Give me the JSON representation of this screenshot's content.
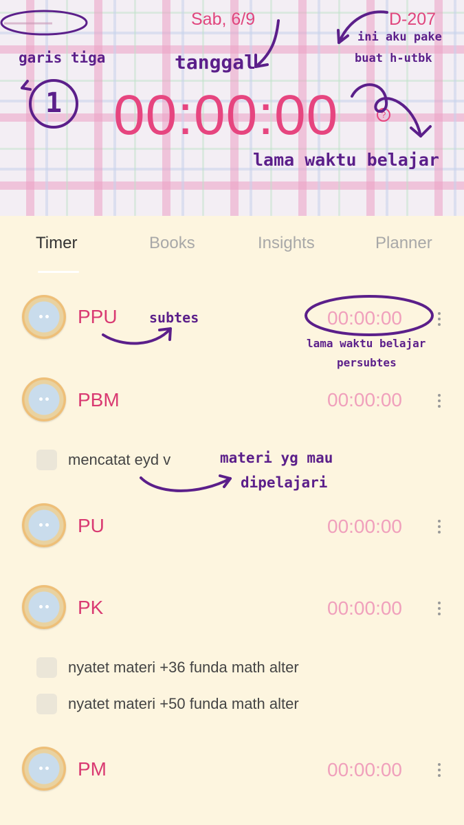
{
  "header": {
    "date": "Sab, 6/9",
    "dday": "D-207",
    "timer": "00:00:00",
    "help_glyph": "?"
  },
  "annotations": {
    "menu": "garis tiga",
    "menu_number": "1",
    "date": "tanggal",
    "dday_line1": "ini aku pake",
    "dday_line2": "buat h-utbk",
    "timer": "lama waktu belajar",
    "subtes": "subtes",
    "row_timer_line1": "lama waktu belajar",
    "row_timer_line2": "persubtes",
    "materi_line1": "materi yg mau",
    "materi_line2": "dipelajari"
  },
  "tabs": [
    {
      "label": "Timer",
      "active": true
    },
    {
      "label": "Books",
      "active": false
    },
    {
      "label": "Insights",
      "active": false
    },
    {
      "label": "Planner",
      "active": false
    }
  ],
  "subjects": [
    {
      "name": "PPU",
      "time": "00:00:00"
    },
    {
      "name": "PBM",
      "time": "00:00:00",
      "tasks": [
        "mencatat eyd v"
      ]
    },
    {
      "name": "PU",
      "time": "00:00:00"
    },
    {
      "name": "PK",
      "time": "00:00:00",
      "tasks": [
        "nyatet materi +36 funda math alter",
        "nyatet materi +50 funda math alter"
      ]
    },
    {
      "name": "PM",
      "time": "00:00:00"
    }
  ],
  "colors": {
    "accent": "#e0457d",
    "annotation": "#5b1f8a",
    "background": "#fdf5df"
  }
}
